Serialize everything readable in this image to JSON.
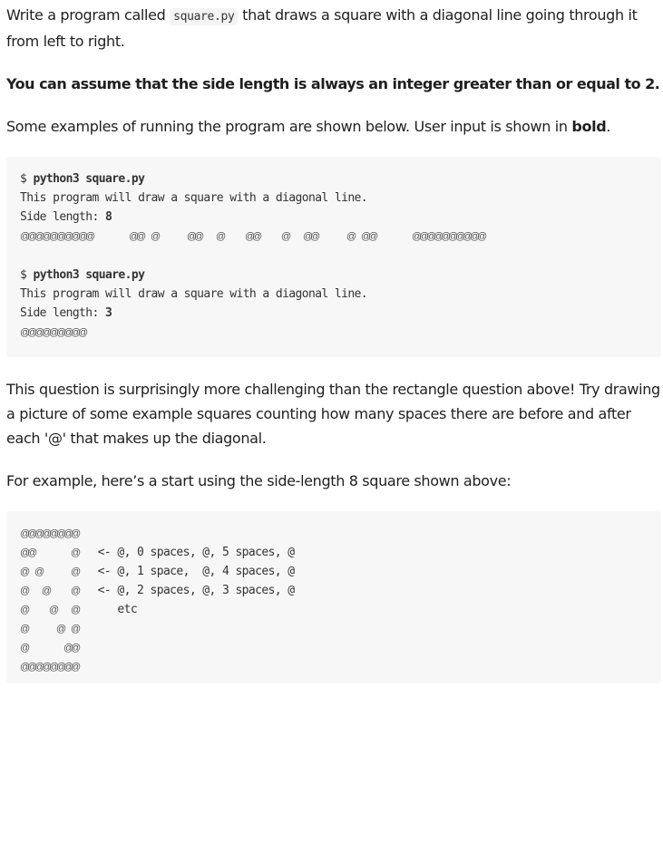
{
  "intro": {
    "before_code": "Write a program called ",
    "code": "square.py",
    "after_code": " that draws a square with a diagonal line going through it from left to right."
  },
  "assumption": "You can assume that the side length is always an integer greater than or equal to 2.",
  "examples_intro": {
    "before_bold": "Some examples of running the program are shown below. User input is shown in ",
    "bold": "bold",
    "after_bold": "."
  },
  "example1": {
    "prompt": "$ ",
    "command": "python3 square.py",
    "output_line": "This program will draw a square with a diagonal line.",
    "side_label": "Side length: ",
    "side_value": "8",
    "square": [
      "@@@@@@@@",
      "@@     @",
      "@ @    @",
      "@  @   @",
      "@   @  @",
      "@    @ @",
      "@     @@",
      "@@@@@@@@"
    ]
  },
  "example2": {
    "prompt": "$ ",
    "command": "python3 square.py",
    "output_line": "This program will draw a square with a diagonal line.",
    "side_label": "Side length: ",
    "side_value": "3",
    "square": [
      "@@@",
      "@@@",
      "@@@"
    ]
  },
  "challenge_text": "This question is surprisingly more challenging than the rectangle question above! Try drawing a picture of some example squares counting how many spaces there are before and after each '@' that makes up the diagonal.",
  "start_text": "For example, here’s a start using the side-length 8 square shown above:",
  "example3": {
    "square": [
      "@@@@@@@@",
      "@@     @",
      "@ @    @",
      "@  @   @",
      "@   @  @",
      "@    @ @",
      "@     @@",
      "@@@@@@@@"
    ],
    "annotations": [
      "",
      "   <- @, 0 spaces, @, 5 spaces, @",
      "   <- @, 1 space,  @, 4 spaces, @",
      "   <- @, 2 spaces, @, 3 spaces, @",
      "      etc",
      "",
      "",
      ""
    ]
  }
}
